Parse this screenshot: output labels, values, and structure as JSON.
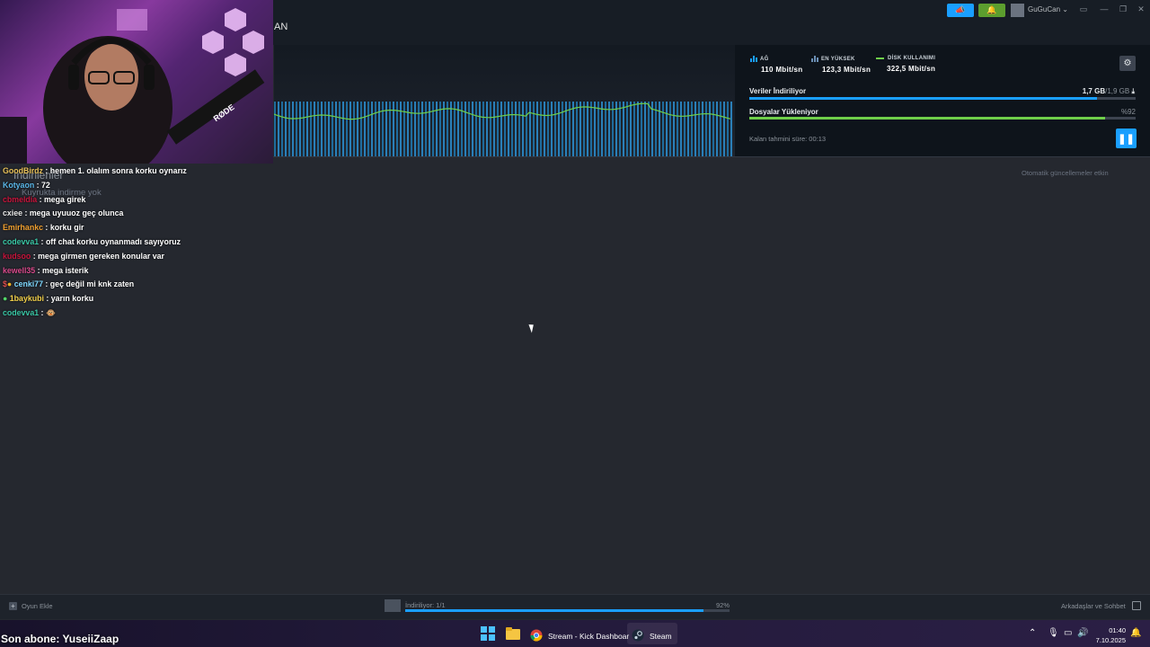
{
  "header": {
    "title_fragment": "AN",
    "username": "GuGuCan",
    "colors": {
      "announce": "#1a9fff",
      "notifications": "#5c9e2e"
    }
  },
  "stats": {
    "network": {
      "label": "AĞ",
      "value": "110 Mbit/sn"
    },
    "peak": {
      "label": "EN YÜKSEK",
      "value": "123,3 Mbit/sn"
    },
    "disk": {
      "label": "DİSK KULLANIMI",
      "value": "322,5 Mbit/sn"
    }
  },
  "progress": {
    "downloading": {
      "label": "Veriler İndiriliyor",
      "done": "1,7 GB",
      "total": "/1,9 GB",
      "fraction": 0.9
    },
    "installing": {
      "label": "Dosyalar Yükleniyor",
      "value": "%92",
      "fraction": 0.92
    },
    "eta": "Kalan tahmini süre: 00:13"
  },
  "downloads": {
    "auto_updates": "Otomatik güncellemeler etkin",
    "title": "İndirilenler",
    "queue_empty": "Kuyrukta indirme yok"
  },
  "chat": [
    {
      "user": "GoodBirdz",
      "text": "hemen 1. olalım sonra korku oynarız",
      "color": "#e8c15a"
    },
    {
      "user": "Kotyaon",
      "text": "72",
      "color": "#5ab7e8"
    },
    {
      "user": "cbmeldia",
      "text": "mega girek",
      "color": "#c8143c"
    },
    {
      "user": "cxiee",
      "text": "mega uyuuoz geç olunca",
      "color": "#e8e8e8"
    },
    {
      "user": "Emirhankc",
      "text": "korku gir",
      "color": "#f0a030"
    },
    {
      "user": "codevva1",
      "text": "off chat korku oynanmadı sayıyoruz",
      "color": "#39c6a5"
    },
    {
      "user": "kudsoo",
      "text": "mega girmen gereken konular var",
      "color": "#c8143c"
    },
    {
      "user": "kewell35",
      "text": "mega isterik",
      "color": "#d94a8c"
    },
    {
      "user": "cenki77",
      "text": "geç değil mi knk zaten",
      "color": "#7fd8ff"
    },
    {
      "user": "1baykubi",
      "text": "yarın korku",
      "color": "#f2d04a"
    },
    {
      "user": "codevva1",
      "text": "🐵",
      "color": "#39c6a5"
    }
  ],
  "bottom": {
    "add_game": "Oyun Ekle",
    "downloading": "İndiriliyor: 1/1",
    "percent": "92%",
    "download_fraction": 0.92,
    "friends": "Arkadaşlar ve Sohbet"
  },
  "overlay": {
    "subscriber": "Son abone: YuseiiZaap"
  },
  "taskbar": {
    "chrome_label": "Stream - Kick Dashboar",
    "steam_label": "Steam",
    "time": "01:40",
    "date": "7.10.2025"
  }
}
